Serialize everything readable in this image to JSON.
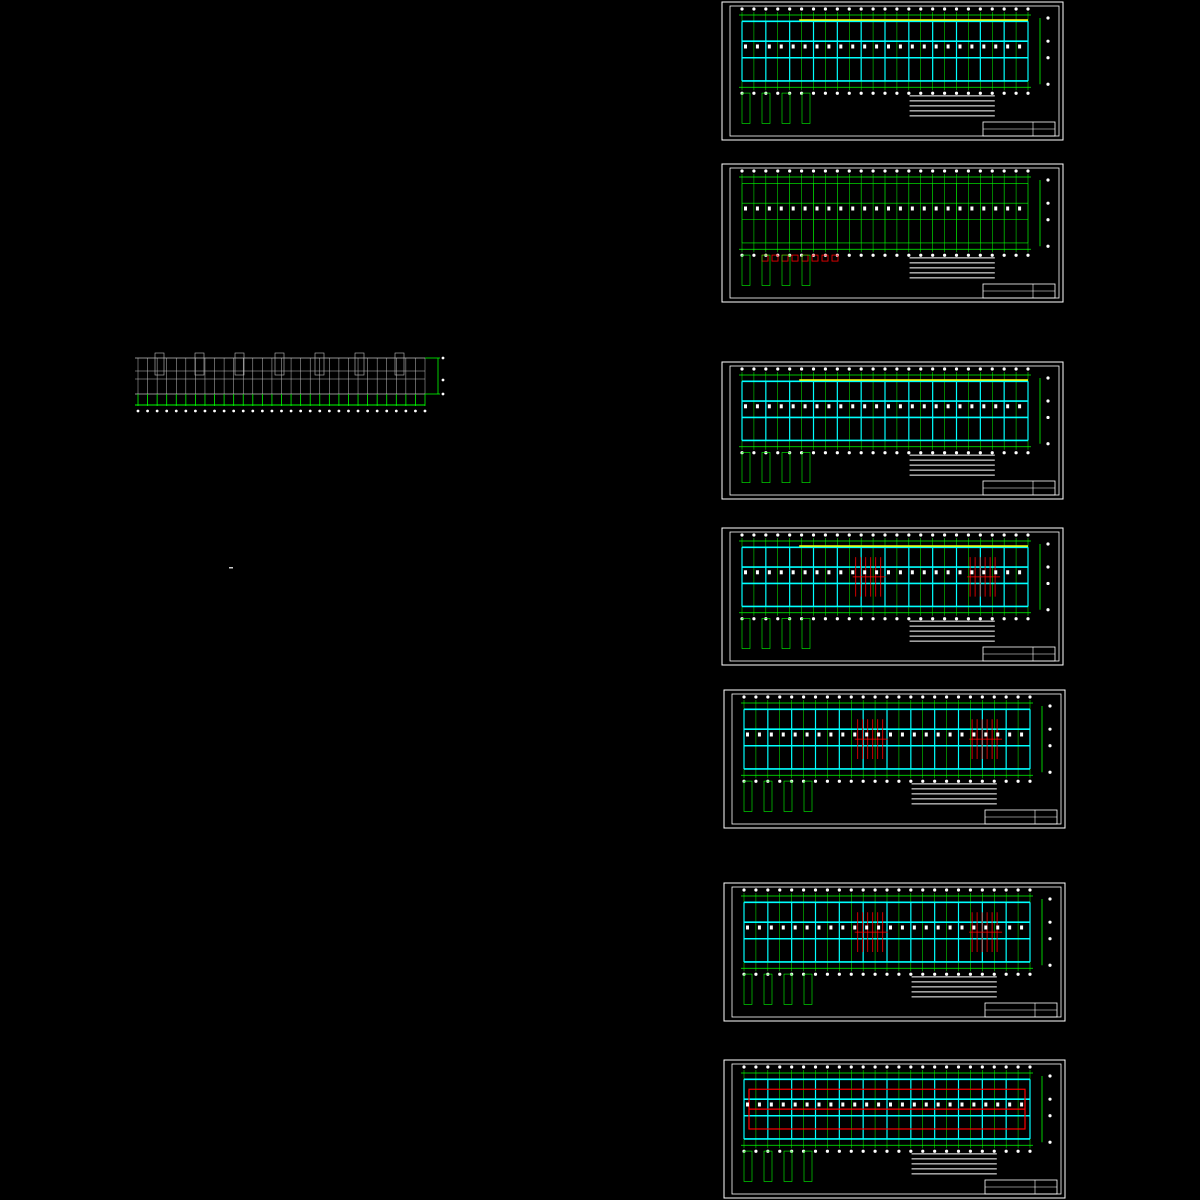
{
  "viewport": {
    "background": "#000000"
  },
  "colors": {
    "frame": "#ffffff",
    "axis": "#00ff00",
    "beam": "#00ffff",
    "wall": "#c0c0c0",
    "highlight": "#ffff00",
    "rebar": "#ff0000",
    "accent": "#ff00ff"
  },
  "sheets": [
    {
      "id": 1,
      "theme": "foundation",
      "colors": [
        "#00ffff",
        "#ffff00"
      ]
    },
    {
      "id": 2,
      "theme": "column-layout",
      "colors": [
        "#00ff00",
        "#ff0000"
      ]
    },
    {
      "id": 3,
      "theme": "floor-plan",
      "colors": [
        "#00ffff",
        "#ffff00"
      ]
    },
    {
      "id": 4,
      "theme": "floor-plan",
      "colors": [
        "#00ffff",
        "#ff0000",
        "#ffff00"
      ]
    },
    {
      "id": 5,
      "theme": "slab-reinforcement",
      "colors": [
        "#00ffff",
        "#ff0000"
      ]
    },
    {
      "id": 6,
      "theme": "slab-reinforcement",
      "colors": [
        "#00ffff",
        "#ff0000"
      ]
    },
    {
      "id": 7,
      "theme": "roof-plan",
      "colors": [
        "#00ffff",
        "#ff0000"
      ]
    }
  ],
  "loose_plan": {
    "theme": "grid-plan",
    "colors": [
      "#c0c0c0",
      "#00ff00"
    ]
  }
}
